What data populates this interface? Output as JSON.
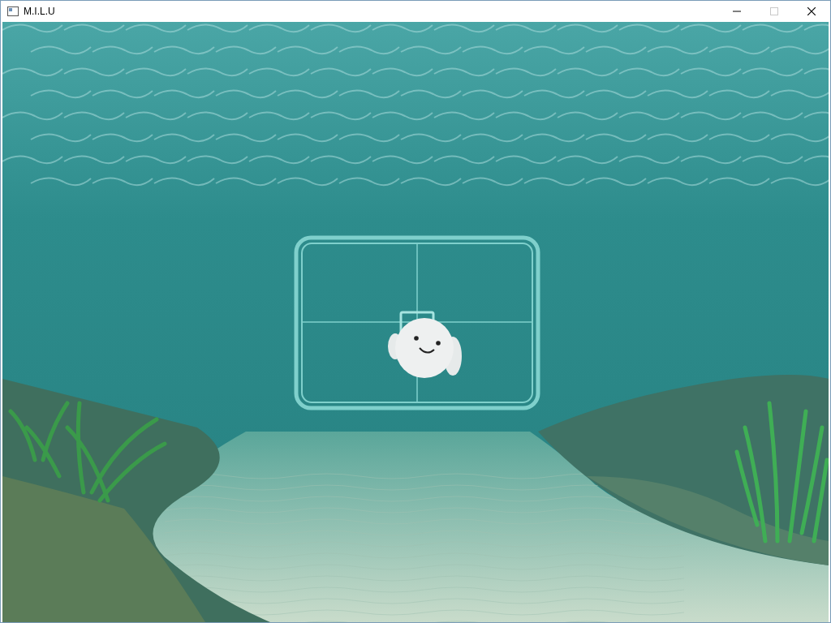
{
  "window": {
    "title": "M.I.L.U",
    "controls": [
      {
        "kind": "minimize",
        "disabled": false
      },
      {
        "kind": "maximize",
        "disabled": true
      },
      {
        "kind": "close",
        "disabled": false
      }
    ]
  }
}
